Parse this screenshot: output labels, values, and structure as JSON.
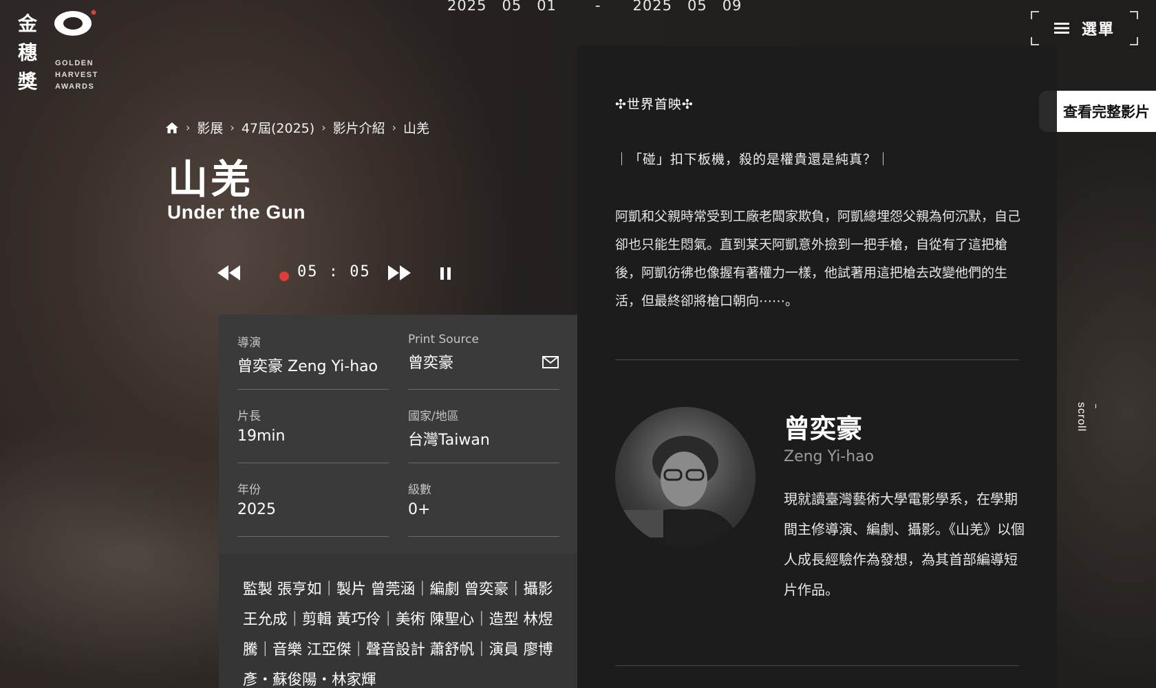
{
  "logo": {
    "cjk": "金穗獎",
    "en_line1": "GOLDEN",
    "en_line2": "HARVEST",
    "en_line3": "AWARDS"
  },
  "dates": {
    "start_year": "2025",
    "start_month": "05",
    "start_day": "01",
    "separator": "-",
    "end_year": "2025",
    "end_month": "05",
    "end_day": "09"
  },
  "menu": {
    "label": "選單",
    "icon": "hamburger-icon"
  },
  "breadcrumb": {
    "home_icon": "home-icon",
    "items": [
      "影展",
      "47屆(2025)",
      "影片介紹",
      "山羌"
    ]
  },
  "film": {
    "title_cn": "山羌",
    "title_en": "Under the Gun"
  },
  "player": {
    "timer": "05 : 05",
    "rewind_icon": "rewind-icon",
    "forward_icon": "fast-forward-icon",
    "pause_icon": "pause-icon"
  },
  "info": {
    "director_label": "導演",
    "director_value": "曾奕豪 Zeng Yi-hao",
    "print_source_label": "Print Source",
    "print_source_value": "曾奕豪",
    "length_label": "片長",
    "length_value": "19min",
    "country_label": "國家/地區",
    "country_value": "台灣Taiwan",
    "year_label": "年份",
    "year_value": "2025",
    "rating_label": "級數",
    "rating_value": "0+"
  },
  "credits": "監製 張亨如｜製片 曾莞涵｜編劇 曾奕豪｜攝影 王允成｜剪輯 黃巧伶｜美術 陳聖心｜造型 林煜騰｜音樂 江亞傑｜聲音設計 蕭舒帆｜演員 廖博彥・蘇俊陽・林家輝",
  "side": {
    "premiere": "✣世界首映✣",
    "tagline": "｜「碰」扣下板機，殺的是權貴還是純真？｜",
    "synopsis": "阿凱和父親時常受到工廠老闆家欺負，阿凱總埋怨父親為何沉默，自己卻也只能生悶氣。直到某天阿凱意外撿到一把手槍，自從有了這把槍後，阿凱彷彿也像握有著權力一樣，他試著用這把槍去改變他們的生活，但最終卻將槍口朝向⋯⋯。",
    "director_name_cn": "曾奕豪",
    "director_name_en": "Zeng Yi-hao",
    "director_bio": "現就讀臺灣藝術大學電影學系，在學期間主修導演、編劇、攝影。《山羌》以個人成長經驗作為發想，為其首部編導短片作品。"
  },
  "full_film_label": "查看完整影片",
  "scroll_label": "scroll",
  "colors": {
    "accent_red": "#e03c3c",
    "panel_dark": "#1c1c1c",
    "panel_gray": "#3a3a3a"
  }
}
